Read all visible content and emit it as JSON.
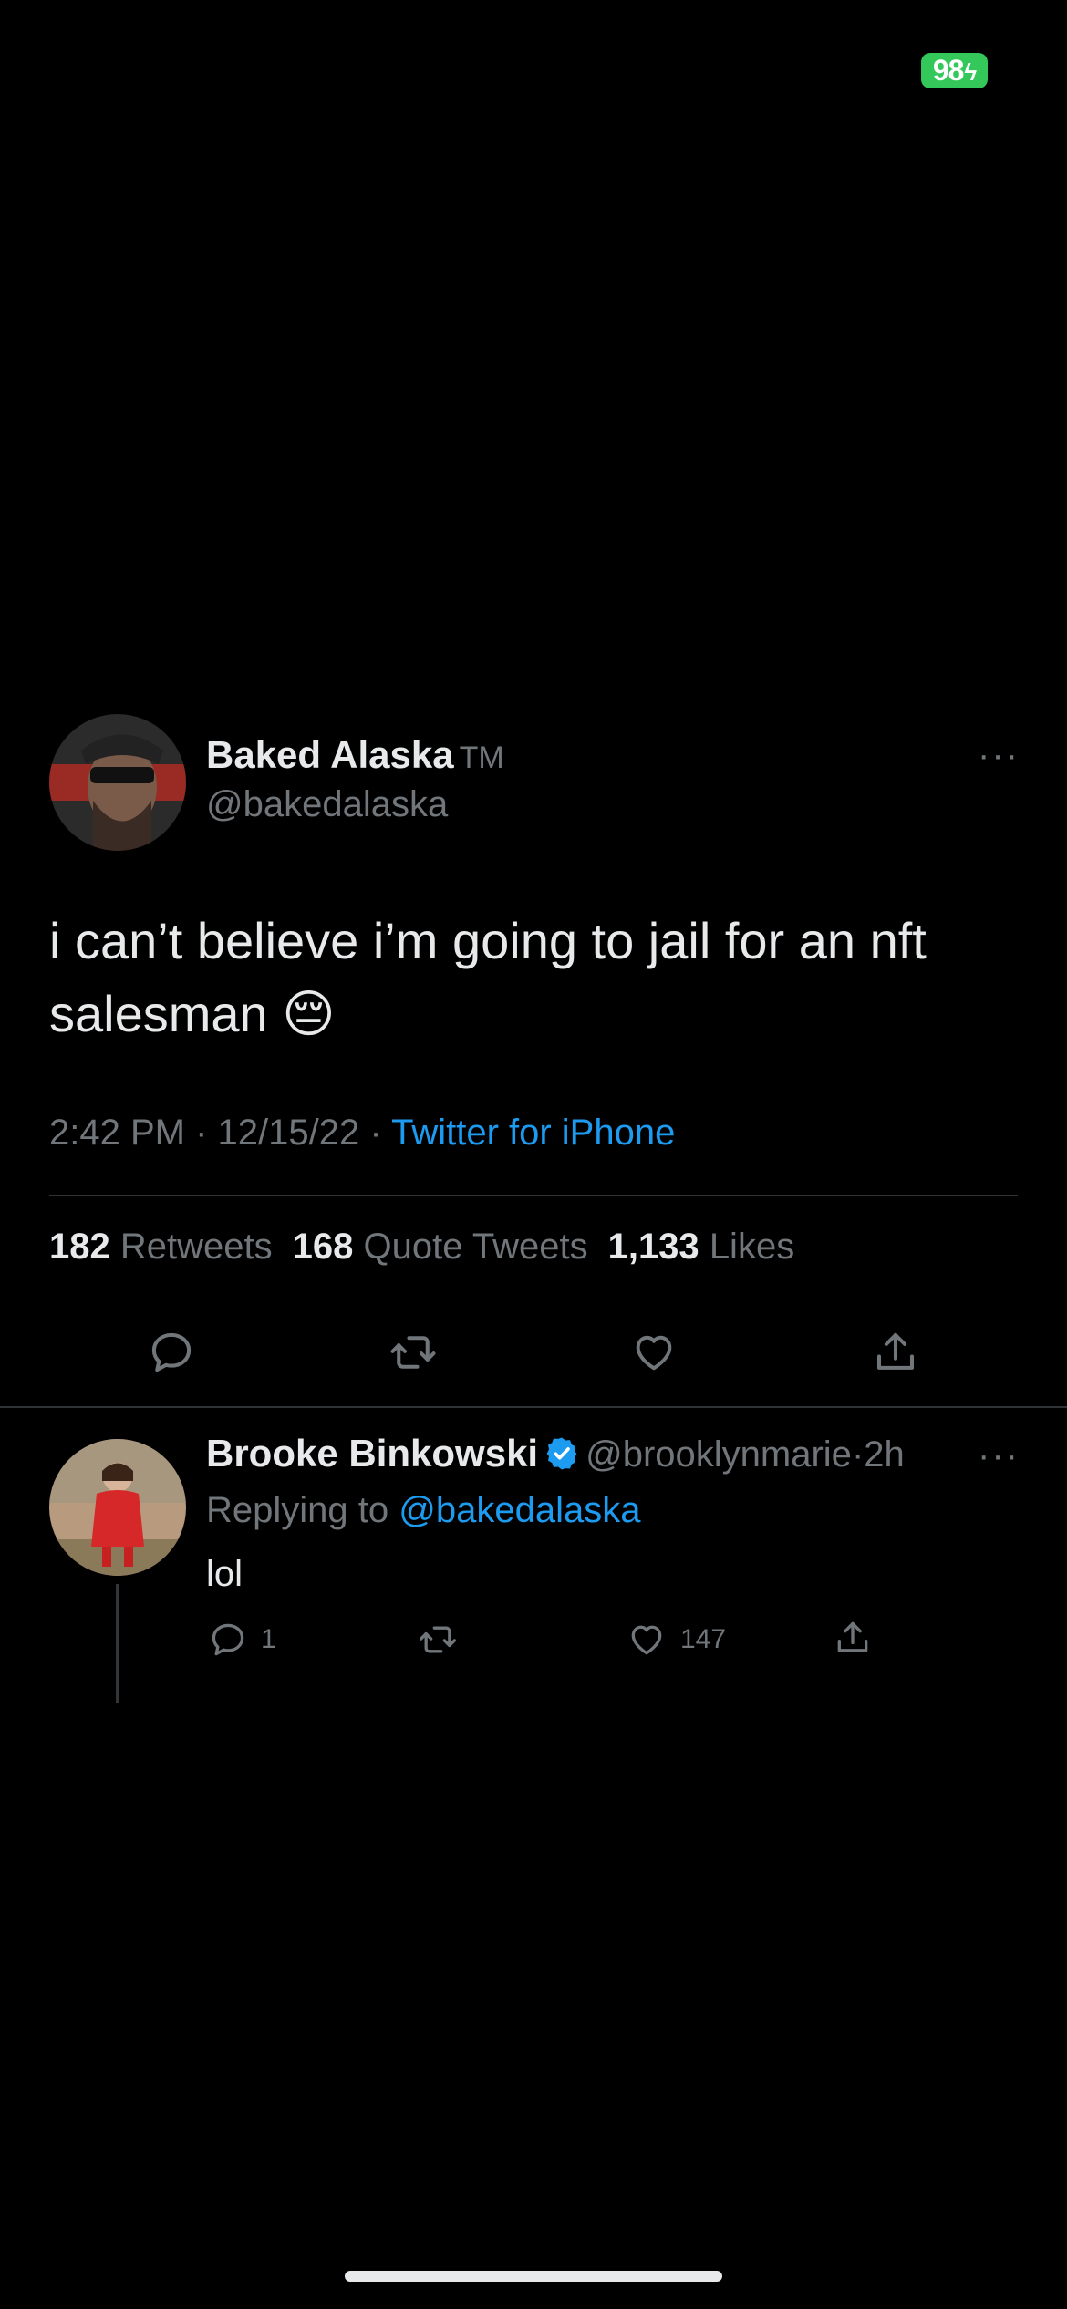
{
  "status_bar": {
    "battery": "98"
  },
  "tweet": {
    "author_name": "Baked Alaska",
    "author_suffix": "TM",
    "author_handle": "@bakedalaska",
    "more": "···",
    "text": "i can’t believe i’m going to jail for an nft salesman 😔",
    "time": "2:42 PM",
    "date": "12/15/22",
    "separator": "·",
    "source": "Twitter for iPhone",
    "stats": {
      "retweets_count": "182",
      "retweets_label": "Retweets",
      "quotes_count": "168",
      "quotes_label": "Quote Tweets",
      "likes_count": "1,133",
      "likes_label": "Likes"
    }
  },
  "reply": {
    "author_name": "Brooke Binkowski",
    "author_handle": "@brooklynmarie",
    "time_ago": "2h",
    "separator": "·",
    "more": "···",
    "replying_prefix": "Replying to",
    "replying_to": "@bakedalaska",
    "text": "lol",
    "reply_count": "1",
    "like_count": "147"
  },
  "colors": {
    "background": "#000000",
    "text": "#e7e9ea",
    "secondary": "#71767b",
    "accent": "#1d9bf0",
    "battery": "#34c759"
  },
  "icons": [
    "reply-icon",
    "retweet-icon",
    "like-icon",
    "share-icon",
    "verified-icon",
    "more-icon"
  ]
}
